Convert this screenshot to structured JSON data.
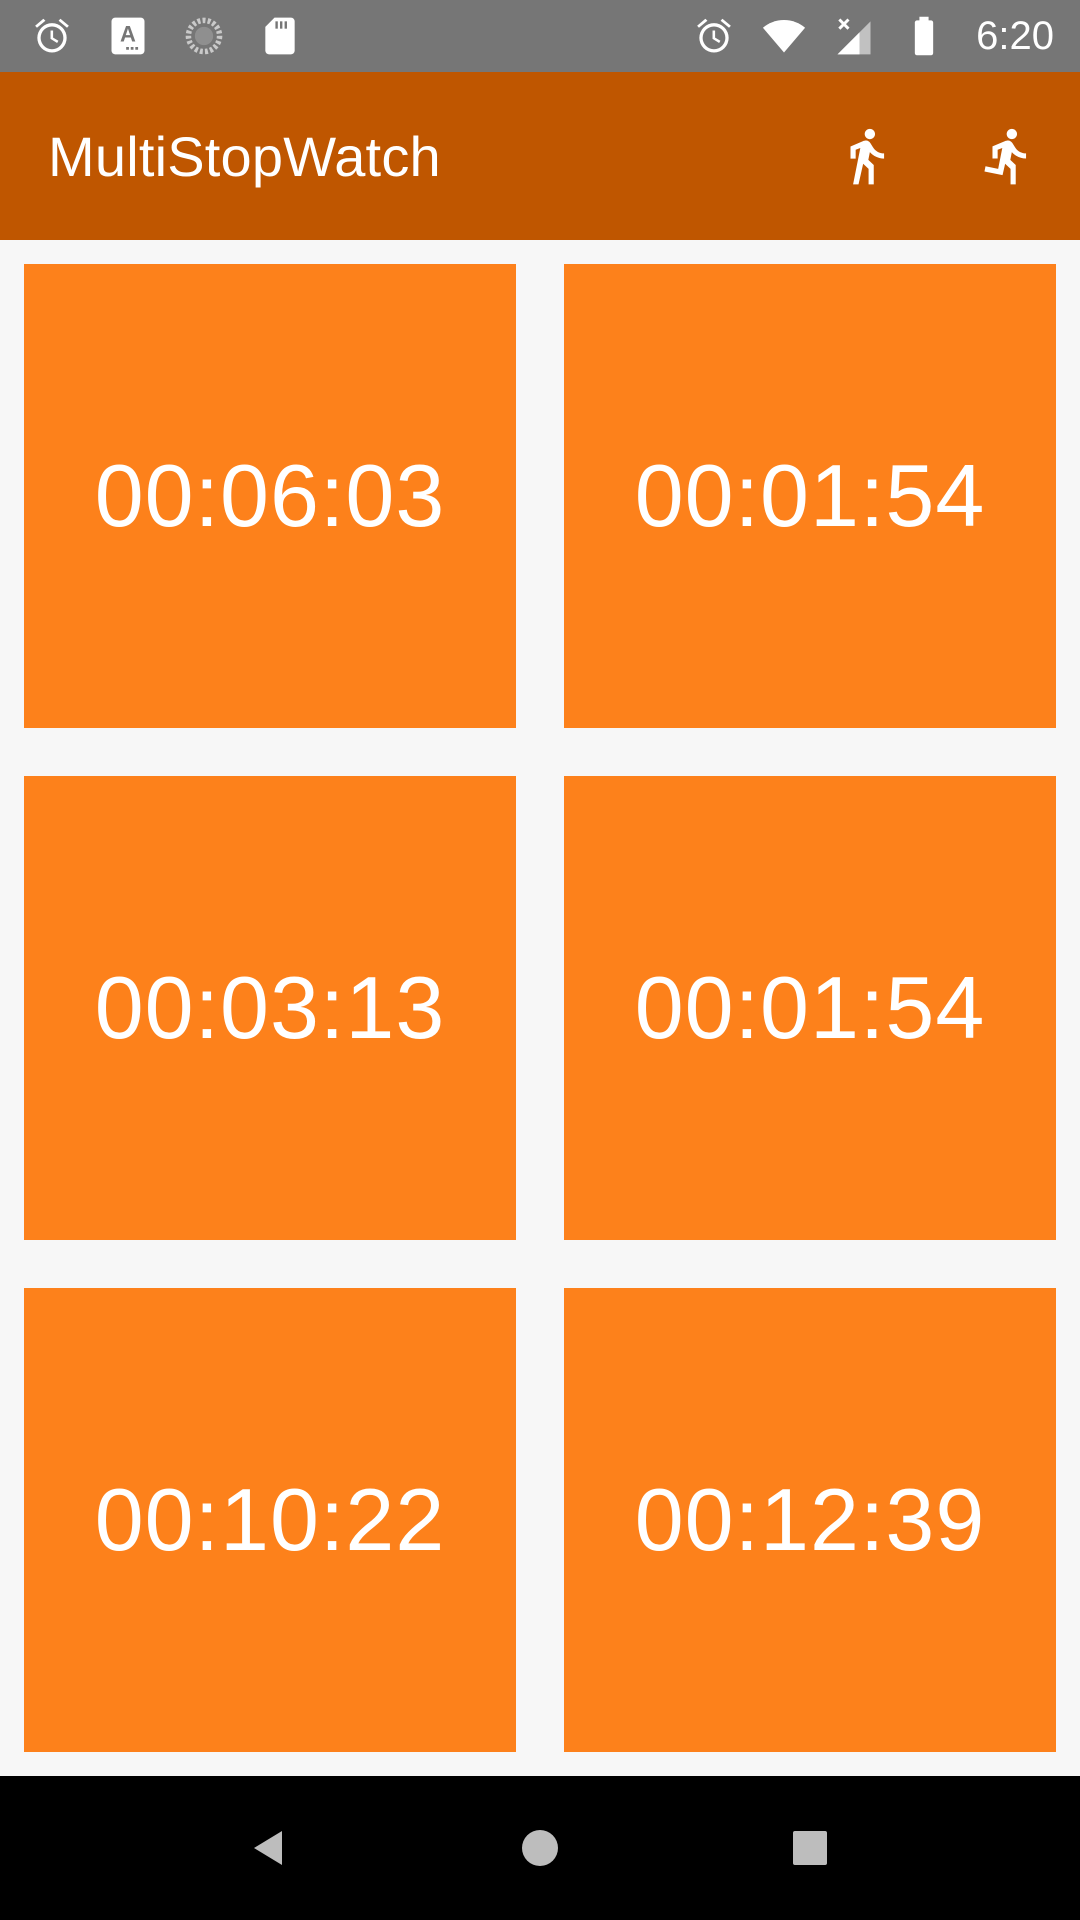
{
  "status_bar": {
    "time": "6:20",
    "left_icons": [
      "alarm-icon",
      "keyboard-a-icon",
      "sync-spinner-icon",
      "sd-card-icon"
    ],
    "right_icons": [
      "alarm-icon",
      "wifi-icon",
      "cell-signal-no-service-icon",
      "battery-icon"
    ]
  },
  "app_bar": {
    "title": "MultiStopWatch",
    "actions": [
      "walk-icon",
      "run-icon"
    ]
  },
  "stopwatches": [
    {
      "time": "00:06:03"
    },
    {
      "time": "00:01:54"
    },
    {
      "time": "00:03:13"
    },
    {
      "time": "00:01:54"
    },
    {
      "time": "00:10:22"
    },
    {
      "time": "00:12:39"
    }
  ],
  "nav_bar": {
    "buttons": [
      "back-icon",
      "home-icon",
      "recents-icon"
    ]
  },
  "colors": {
    "status_bar": "#767676",
    "app_bar": "#bf5600",
    "tile": "#fd811b",
    "background": "#f7f7f7",
    "nav_bar": "#000000",
    "text": "#ffffff"
  }
}
